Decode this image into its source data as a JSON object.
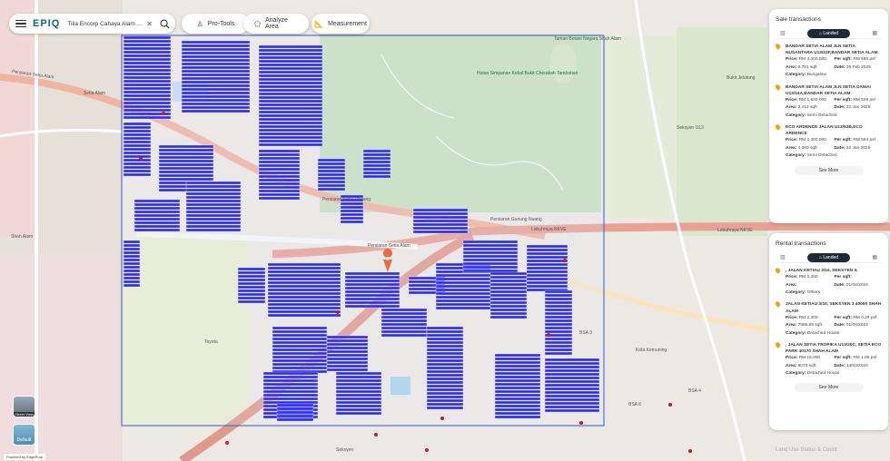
{
  "app": {
    "brand": "EPIQ",
    "location": "Tilia Encorp Cahaya Alam Sha...",
    "clear_icon": "close-icon",
    "search_icon": "search-icon"
  },
  "toolbar": {
    "pro_tools": {
      "label": "Pro-Tools",
      "icon": "person-icon"
    },
    "analyze_area": {
      "label": "Analyze Area",
      "icon": "polygon-icon"
    },
    "measurement": {
      "label": "Measurement",
      "icon": "ruler-icon"
    }
  },
  "map": {
    "labels": [
      "Persiaran Setia Alam",
      "Setia Alam",
      "Taman Botani Negara Shah Alam",
      "Hutan Simpanan Kekal Bukit Cherakah Tambahan",
      "Persiaran Setia Dagang",
      "Lebuhraya NKVE",
      "Persiaran Gunung Nuang",
      "Bukit Jelutong",
      "Seksyen U13",
      "Seksyen",
      "Toyota",
      "BSA 3",
      "BSA 4",
      "BSA 6",
      "Shah Alam",
      "Kota Kemuning"
    ],
    "accent_color": "#0000ee",
    "pin_color": "#f06a3a",
    "layers": {
      "street": "Street View",
      "default": "Default"
    }
  },
  "sale": {
    "title": "Sale transactions",
    "filter": "Landed",
    "items": [
      {
        "addr": "BANDAR SETIA ALAM        JLN SETIA NUSANTARA U13/22F,BANDAR SETIA ALAM",
        "price": "RM 4,000,000",
        "psf": "RM 590 psf",
        "area": "6,781 sqft",
        "date": "25 Feb 2025",
        "category": "Bungalow"
      },
      {
        "addr": "BANDAR SETIA ALAM        JLN SETIA DAMAI U13/14A,BANDAR SETIA ALAM",
        "price": "RM 1,630,000",
        "psf": "RM 529 psf",
        "area": "3,412 sqft",
        "date": "22 Jan 2025",
        "category": "Semi Detached"
      },
      {
        "addr": "ECO ARDENCE        JALAN U13/52B,ECO ARDENCE",
        "price": "RM 2,300,000",
        "psf": "RM 564 psf",
        "area": "4,080 sqft",
        "date": "22 Jan 2025",
        "category": "Semi Detached"
      }
    ],
    "see_more": "See More"
  },
  "rental": {
    "title": "Rental transactions",
    "filter": "Landed",
    "items": [
      {
        "addr": ", JALAN KETIAU 3/10, SEKSYEN 3,",
        "price": "RM 2,300",
        "psf": "",
        "area": "",
        "date": "01/04/2024",
        "category": "Others"
      },
      {
        "addr": "JALAN KETIAU 3/10, SEKSYEN 3 40000 SHAH ALAM",
        "price": "RM 2,300",
        "psf": "RM 0.29 psf",
        "area": "7866.69 sqft",
        "date": "01/04/2024",
        "category": "Detached House"
      },
      {
        "addr": ", JALAN SETIA TROPIKA U13/20C, SETIA ECO PARK 40170 SHAH ALAM",
        "price": "RM 15,000",
        "psf": "RM 1.86 psf",
        "area": "8073 sqft",
        "date": "14/03/2024",
        "category": "Detached House"
      }
    ],
    "see_more": "See More"
  },
  "labels": {
    "price": "Price:",
    "psf": "Per sqft:",
    "area": "Area:",
    "date": "Date:",
    "category": "Category:"
  },
  "land_use": "Land Use Status & Count",
  "powered": "Powered by EdgeProp"
}
